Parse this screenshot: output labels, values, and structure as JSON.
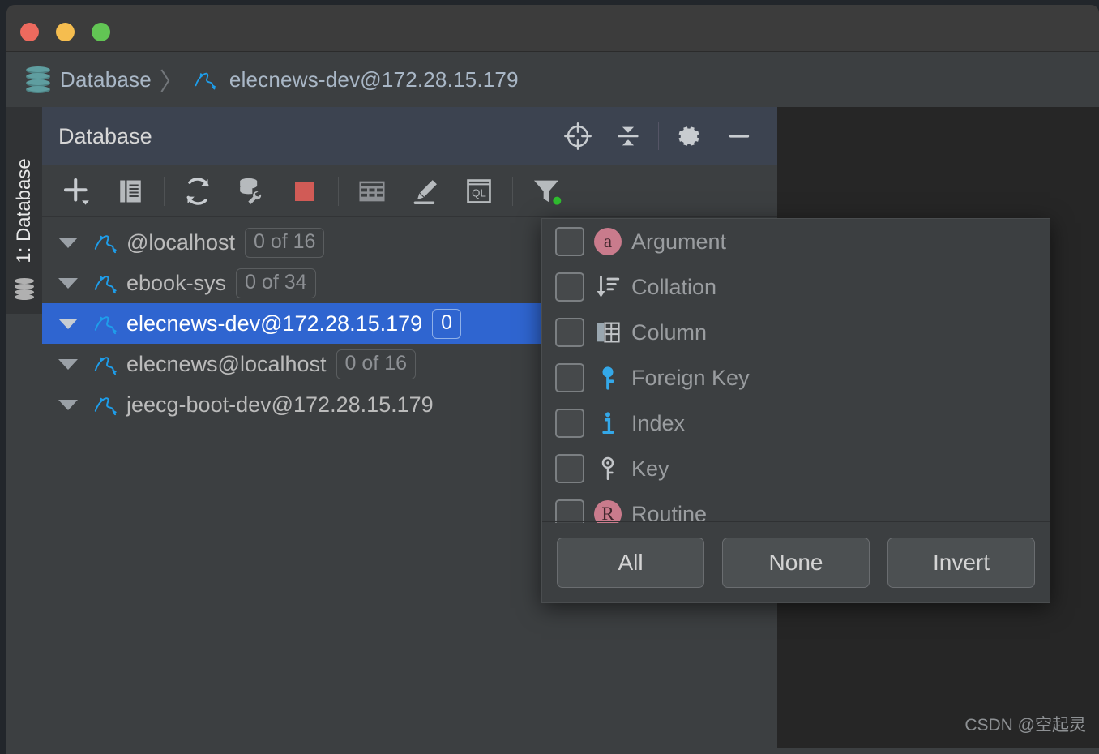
{
  "window": {
    "traffic_lights": [
      "close",
      "minimize",
      "zoom"
    ],
    "colors": {
      "close": "#ed6a5e",
      "minimize": "#f5bd4f",
      "zoom": "#62c554"
    }
  },
  "breadcrumb": {
    "root_icon": "database-stack-icon",
    "root_label": "Database",
    "separator": "〉",
    "leaf_icon": "mysql-dolphin-icon",
    "leaf_label": "elecnews-dev@172.28.15.179"
  },
  "stripe": {
    "label": "1: Database",
    "icon": "database-stack-icon"
  },
  "tool_window": {
    "title": "Database",
    "header_actions": [
      {
        "name": "scroll-from-source-icon",
        "label": "Scroll from Source"
      },
      {
        "name": "collapse-all-icon",
        "label": "Collapse All"
      },
      {
        "name": "settings-gear-icon",
        "label": "Settings"
      },
      {
        "name": "hide-minimize-icon",
        "label": "Hide"
      }
    ],
    "toolbar_actions": [
      {
        "name": "add-new-icon",
        "label": "New"
      },
      {
        "name": "duplicate-icon",
        "label": "Duplicate"
      },
      {
        "name": "refresh-icon",
        "label": "Refresh"
      },
      {
        "name": "db-tools-icon",
        "label": "Database Tools"
      },
      {
        "name": "stop-icon",
        "label": "Stop"
      },
      {
        "name": "table-editor-icon",
        "label": "Table Editor"
      },
      {
        "name": "modify-icon",
        "label": "Modify"
      },
      {
        "name": "query-console-icon",
        "label": "QL Console"
      },
      {
        "name": "filter-funnel-icon",
        "label": "Filter",
        "badge": "active-dot"
      }
    ],
    "accent_color": "#2f65d0",
    "filter_dot_color": "#2fbd2f"
  },
  "tree": {
    "rows": [
      {
        "icon": "mysql-dolphin-icon",
        "label": "@localhost",
        "badge": "0 of 16",
        "selected": false,
        "expanded": true
      },
      {
        "icon": "mysql-dolphin-icon",
        "label": "ebook-sys",
        "badge": "0 of 34",
        "selected": false,
        "expanded": true
      },
      {
        "icon": "mysql-dolphin-icon",
        "label": "elecnews-dev@172.28.15.179",
        "badge": "0",
        "selected": true,
        "expanded": true
      },
      {
        "icon": "mysql-dolphin-icon",
        "label": "elecnews@localhost",
        "badge": "0 of 16",
        "selected": false,
        "expanded": true
      },
      {
        "icon": "mysql-dolphin-icon",
        "label": "jeecg-boot-dev@172.28.15.179",
        "badge": "",
        "selected": false,
        "expanded": true
      }
    ]
  },
  "filter_popup": {
    "items": [
      {
        "icon": "argument-badge-icon",
        "label": "Argument",
        "checked": false
      },
      {
        "icon": "collation-sort-icon",
        "label": "Collation",
        "checked": false
      },
      {
        "icon": "column-table-icon",
        "label": "Column",
        "checked": false
      },
      {
        "icon": "foreign-key-icon",
        "label": "Foreign Key",
        "checked": false
      },
      {
        "icon": "index-info-icon",
        "label": "Index",
        "checked": false
      },
      {
        "icon": "key-icon",
        "label": "Key",
        "checked": false
      },
      {
        "icon": "routine-badge-icon",
        "label": "Routine",
        "checked": false
      }
    ],
    "buttons": [
      {
        "name": "select-all-button",
        "label": "All"
      },
      {
        "name": "select-none-button",
        "label": "None"
      },
      {
        "name": "invert-selection-button",
        "label": "Invert"
      }
    ]
  },
  "watermark": {
    "text": "CSDN @空起灵"
  }
}
